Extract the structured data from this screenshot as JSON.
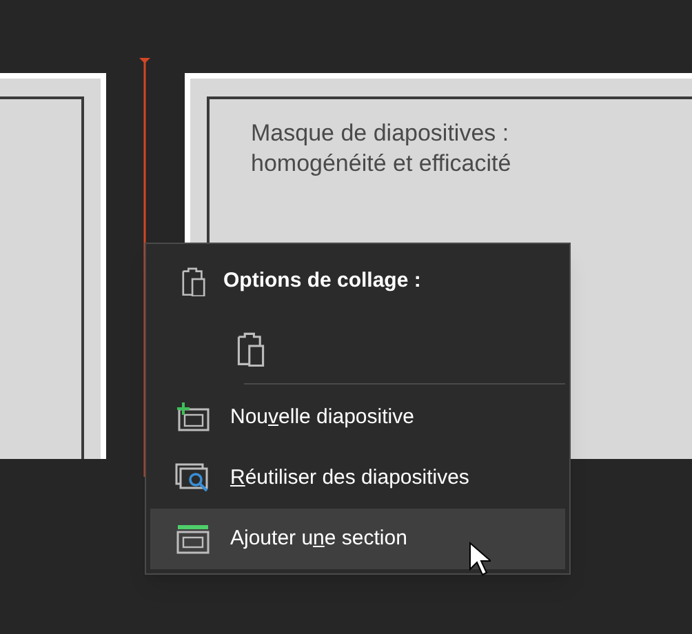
{
  "slides": [
    {
      "kind": "blank"
    },
    {
      "kind": "title",
      "title": "Masque de diapositives : homogénéité et efficacité"
    }
  ],
  "context_menu": {
    "heading": "Options de collage :",
    "items": [
      {
        "kind": "new-slide",
        "label": {
          "before": "Nou",
          "key": "v",
          "after": "elle diapositive"
        },
        "selected": false
      },
      {
        "kind": "reuse",
        "label": {
          "key": "R",
          "after": "éutiliser des diapositives"
        },
        "selected": false
      },
      {
        "kind": "section",
        "label": {
          "before": "Ajouter u",
          "key": "n",
          "after": "e section"
        },
        "selected": true
      }
    ]
  }
}
